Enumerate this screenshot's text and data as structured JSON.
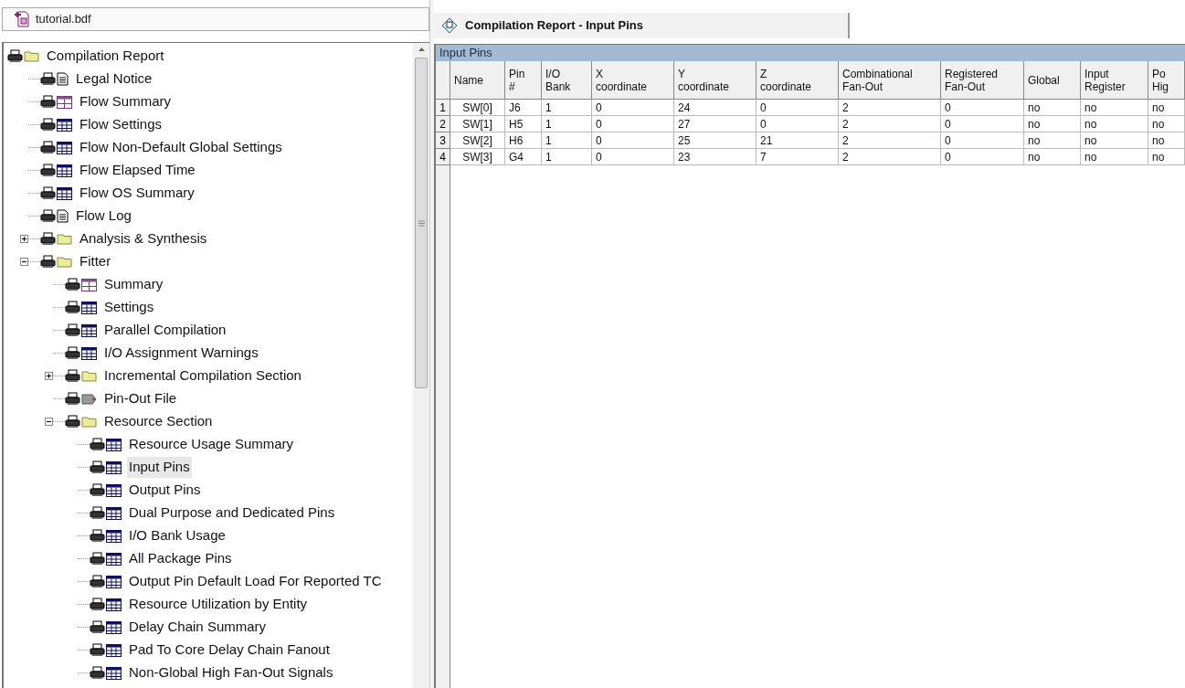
{
  "file_tab": {
    "title": "tutorial.bdf"
  },
  "tree": [
    {
      "label": "Compilation Report",
      "kind": "folder",
      "selected": false,
      "children": [
        {
          "label": "Legal Notice",
          "kind": "text",
          "selected": false
        },
        {
          "label": "Flow Summary",
          "kind": "summary",
          "selected": false
        },
        {
          "label": "Flow Settings",
          "kind": "table",
          "selected": false
        },
        {
          "label": "Flow Non-Default Global Settings",
          "kind": "table",
          "selected": false
        },
        {
          "label": "Flow Elapsed Time",
          "kind": "table",
          "selected": false
        },
        {
          "label": "Flow OS Summary",
          "kind": "table",
          "selected": false
        },
        {
          "label": "Flow Log",
          "kind": "text",
          "selected": false
        },
        {
          "label": "Analysis & Synthesis",
          "kind": "folder",
          "selected": false,
          "expanded": false
        },
        {
          "label": "Fitter",
          "kind": "folder",
          "selected": false,
          "expanded": true,
          "children": [
            {
              "label": "Summary",
              "kind": "summary",
              "selected": false
            },
            {
              "label": "Settings",
              "kind": "table",
              "selected": false
            },
            {
              "label": "Parallel Compilation",
              "kind": "table",
              "selected": false
            },
            {
              "label": "I/O Assignment Warnings",
              "kind": "table",
              "selected": false
            },
            {
              "label": "Incremental Compilation Section",
              "kind": "folder",
              "selected": false,
              "expanded": false
            },
            {
              "label": "Pin-Out File",
              "kind": "pinout",
              "selected": false
            },
            {
              "label": "Resource Section",
              "kind": "folder",
              "selected": false,
              "expanded": true,
              "children": [
                {
                  "label": "Resource Usage Summary",
                  "kind": "table",
                  "selected": false
                },
                {
                  "label": "Input Pins",
                  "kind": "table",
                  "selected": true
                },
                {
                  "label": "Output Pins",
                  "kind": "table",
                  "selected": false
                },
                {
                  "label": "Dual Purpose and Dedicated Pins",
                  "kind": "table",
                  "selected": false
                },
                {
                  "label": "I/O Bank Usage",
                  "kind": "table",
                  "selected": false
                },
                {
                  "label": "All Package Pins",
                  "kind": "table",
                  "selected": false
                },
                {
                  "label": "Output Pin Default Load For Reported TC",
                  "kind": "table",
                  "selected": false
                },
                {
                  "label": "Resource Utilization by Entity",
                  "kind": "table",
                  "selected": false
                },
                {
                  "label": "Delay Chain Summary",
                  "kind": "table",
                  "selected": false
                },
                {
                  "label": "Pad To Core Delay Chain Fanout",
                  "kind": "table",
                  "selected": false
                },
                {
                  "label": "Non-Global High Fan-Out Signals",
                  "kind": "table",
                  "selected": false
                }
              ]
            }
          ]
        }
      ]
    }
  ],
  "report_tab": {
    "title": "Compilation Report - Input Pins"
  },
  "table": {
    "title": "Input Pins",
    "columns": [
      "Name",
      "Pin\n#",
      "I/O\nBank",
      "X\ncoordinate",
      "Y\ncoordinate",
      "Z\ncoordinate",
      "Combinational\nFan-Out",
      "Registered\nFan-Out",
      "Global",
      "Input\nRegister",
      "Po\nHig"
    ],
    "rows": [
      {
        "number": "1",
        "cells": [
          "SW[0]",
          "J6",
          "1",
          "0",
          "24",
          "0",
          "2",
          "0",
          "no",
          "no",
          "no"
        ]
      },
      {
        "number": "2",
        "cells": [
          "SW[1]",
          "H5",
          "1",
          "0",
          "27",
          "0",
          "2",
          "0",
          "no",
          "no",
          "no"
        ]
      },
      {
        "number": "3",
        "cells": [
          "SW[2]",
          "H6",
          "1",
          "0",
          "25",
          "21",
          "2",
          "0",
          "no",
          "no",
          "no"
        ]
      },
      {
        "number": "4",
        "cells": [
          "SW[3]",
          "G4",
          "1",
          "0",
          "23",
          "7",
          "2",
          "0",
          "no",
          "no",
          "no"
        ]
      }
    ]
  }
}
